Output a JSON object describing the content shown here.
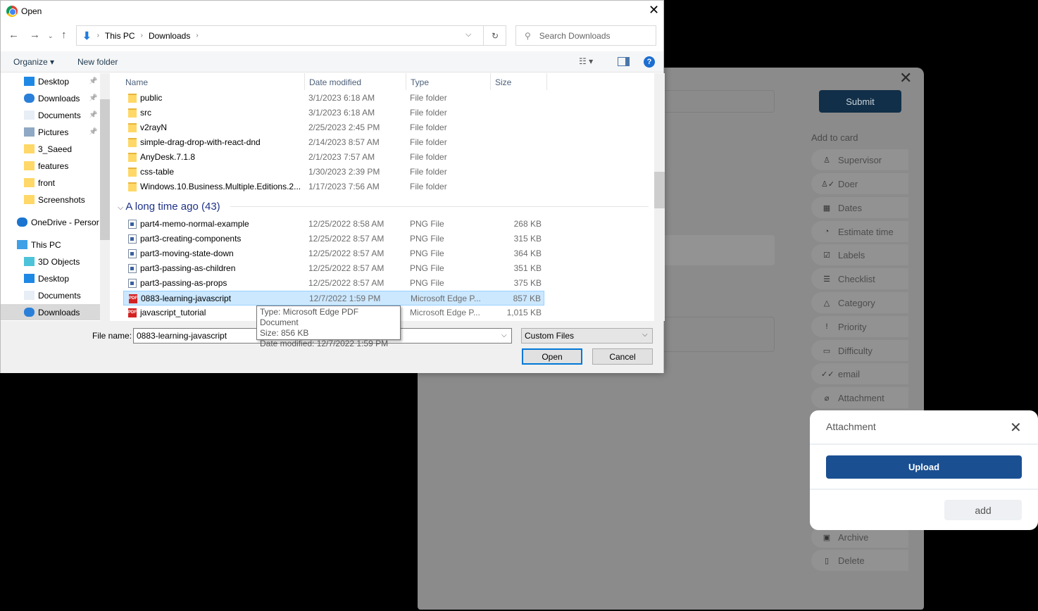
{
  "app": {
    "close_icon": "close-icon",
    "submit_label": "Submit",
    "add_to_card_label": "Add to card",
    "card_actions": [
      {
        "label": "Supervisor",
        "icon": "person-icon"
      },
      {
        "label": "Doer",
        "icon": "person-check-icon"
      },
      {
        "label": "Dates",
        "icon": "calendar-icon"
      },
      {
        "label": "Estimate time",
        "icon": "stopwatch-icon"
      },
      {
        "label": "Labels",
        "icon": "label-icon"
      },
      {
        "label": "Checklist",
        "icon": "checklist-icon"
      },
      {
        "label": "Category",
        "icon": "shapes-icon"
      },
      {
        "label": "Priority",
        "icon": "exclamation-icon"
      },
      {
        "label": "Difficulty",
        "icon": "briefcase-icon"
      },
      {
        "label": "email",
        "icon": "double-check-icon"
      },
      {
        "label": "Attachment",
        "icon": "paperclip-icon"
      },
      {
        "label": "Archive",
        "icon": "archive-icon"
      },
      {
        "label": "Delete",
        "icon": "trash-icon"
      }
    ],
    "colors": {
      "submit": "#112f48",
      "upload": "#1a4f92",
      "overlay": "#8b8b8b"
    }
  },
  "attachment_popover": {
    "title": "Attachment",
    "upload_label": "Upload",
    "add_label": "add"
  },
  "dialog": {
    "title": "Open",
    "breadcrumb": [
      "This PC",
      "Downloads"
    ],
    "search_placeholder": "Search Downloads",
    "toolbar": {
      "organize": "Organize ▾",
      "new_folder": "New folder"
    },
    "nav": [
      {
        "label": "Desktop",
        "icon": "desktop-icon",
        "pinned": true,
        "indent": 1
      },
      {
        "label": "Downloads",
        "icon": "download-icon",
        "pinned": true,
        "indent": 1
      },
      {
        "label": "Documents",
        "icon": "document-icon",
        "pinned": true,
        "indent": 1
      },
      {
        "label": "Pictures",
        "icon": "pictures-icon",
        "pinned": true,
        "indent": 1
      },
      {
        "label": "3_Saeed",
        "icon": "folder-icon",
        "indent": 1
      },
      {
        "label": "features",
        "icon": "folder-icon",
        "indent": 1
      },
      {
        "label": "front",
        "icon": "folder-icon",
        "indent": 1
      },
      {
        "label": "Screenshots",
        "icon": "folder-icon",
        "indent": 1
      },
      {
        "label": "OneDrive - Persor",
        "icon": "onedrive-icon",
        "indent": 0
      },
      {
        "label": "This PC",
        "icon": "pc-icon",
        "indent": 0
      },
      {
        "label": "3D Objects",
        "icon": "cube-icon",
        "indent": 1
      },
      {
        "label": "Desktop",
        "icon": "desktop-icon",
        "indent": 1
      },
      {
        "label": "Documents",
        "icon": "document-icon",
        "indent": 1
      },
      {
        "label": "Downloads",
        "icon": "download-icon",
        "indent": 1,
        "selected": true
      }
    ],
    "columns": [
      "Name",
      "Date modified",
      "Type",
      "Size"
    ],
    "files_recent": [
      {
        "name": "public",
        "date": "3/1/2023 6:18 AM",
        "type": "File folder",
        "size": "",
        "kind": "folder"
      },
      {
        "name": "src",
        "date": "3/1/2023 6:18 AM",
        "type": "File folder",
        "size": "",
        "kind": "folder"
      },
      {
        "name": "v2rayN",
        "date": "2/25/2023 2:45 PM",
        "type": "File folder",
        "size": "",
        "kind": "folder"
      },
      {
        "name": "simple-drag-drop-with-react-dnd",
        "date": "2/14/2023 8:57 AM",
        "type": "File folder",
        "size": "",
        "kind": "folder"
      },
      {
        "name": "AnyDesk.7.1.8",
        "date": "2/1/2023 7:57 AM",
        "type": "File folder",
        "size": "",
        "kind": "folder"
      },
      {
        "name": "css-table",
        "date": "1/30/2023 2:39 PM",
        "type": "File folder",
        "size": "",
        "kind": "folder"
      },
      {
        "name": "Windows.10.Business.Multiple.Editions.2...",
        "date": "1/17/2023 7:56 AM",
        "type": "File folder",
        "size": "",
        "kind": "folder"
      }
    ],
    "group_label": "A long time ago (43)",
    "files_old": [
      {
        "name": "part4-memo-normal-example",
        "date": "12/25/2022 8:58 AM",
        "type": "PNG File",
        "size": "268 KB",
        "kind": "png"
      },
      {
        "name": "part3-creating-components",
        "date": "12/25/2022 8:57 AM",
        "type": "PNG File",
        "size": "315 KB",
        "kind": "png"
      },
      {
        "name": "part3-moving-state-down",
        "date": "12/25/2022 8:57 AM",
        "type": "PNG File",
        "size": "364 KB",
        "kind": "png"
      },
      {
        "name": "part3-passing-as-children",
        "date": "12/25/2022 8:57 AM",
        "type": "PNG File",
        "size": "351 KB",
        "kind": "png"
      },
      {
        "name": "part3-passing-as-props",
        "date": "12/25/2022 8:57 AM",
        "type": "PNG File",
        "size": "375 KB",
        "kind": "png"
      },
      {
        "name": "0883-learning-javascript",
        "date": "12/7/2022 1:59 PM",
        "type": "Microsoft Edge P...",
        "size": "857 KB",
        "kind": "pdf",
        "selected": true
      },
      {
        "name": "javascript_tutorial",
        "date": "",
        "type": "Microsoft Edge P...",
        "size": "1,015 KB",
        "kind": "pdf"
      }
    ],
    "tooltip": [
      "Type: Microsoft Edge PDF Document",
      "Size: 856 KB",
      "Date modified: 12/7/2022 1:59 PM"
    ],
    "file_name_label": "File name:",
    "file_name_value": "0883-learning-javascript",
    "filter_value": "Custom Files",
    "open_label": "Open",
    "cancel_label": "Cancel"
  }
}
